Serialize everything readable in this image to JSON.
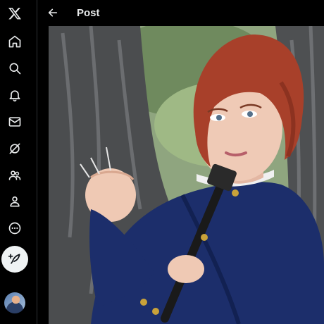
{
  "header": {
    "title": "Post"
  },
  "sidebar": {
    "items": [
      {
        "name": "x-logo",
        "icon": "x-logo-icon"
      },
      {
        "name": "home",
        "icon": "home-icon"
      },
      {
        "name": "explore",
        "icon": "search-icon"
      },
      {
        "name": "notifications",
        "icon": "bell-icon"
      },
      {
        "name": "messages",
        "icon": "mail-icon"
      },
      {
        "name": "grok",
        "icon": "grok-icon"
      },
      {
        "name": "communities",
        "icon": "people-icon"
      },
      {
        "name": "profile",
        "icon": "person-icon"
      },
      {
        "name": "more",
        "icon": "more-circle-icon"
      }
    ],
    "compose_icon": "feather-plus-icon",
    "account_avatar": "avatar"
  },
  "colors": {
    "background": "#000000",
    "text": "#e7e9ea",
    "compose_bg": "#eff3f4",
    "divider": "#2f3336"
  }
}
